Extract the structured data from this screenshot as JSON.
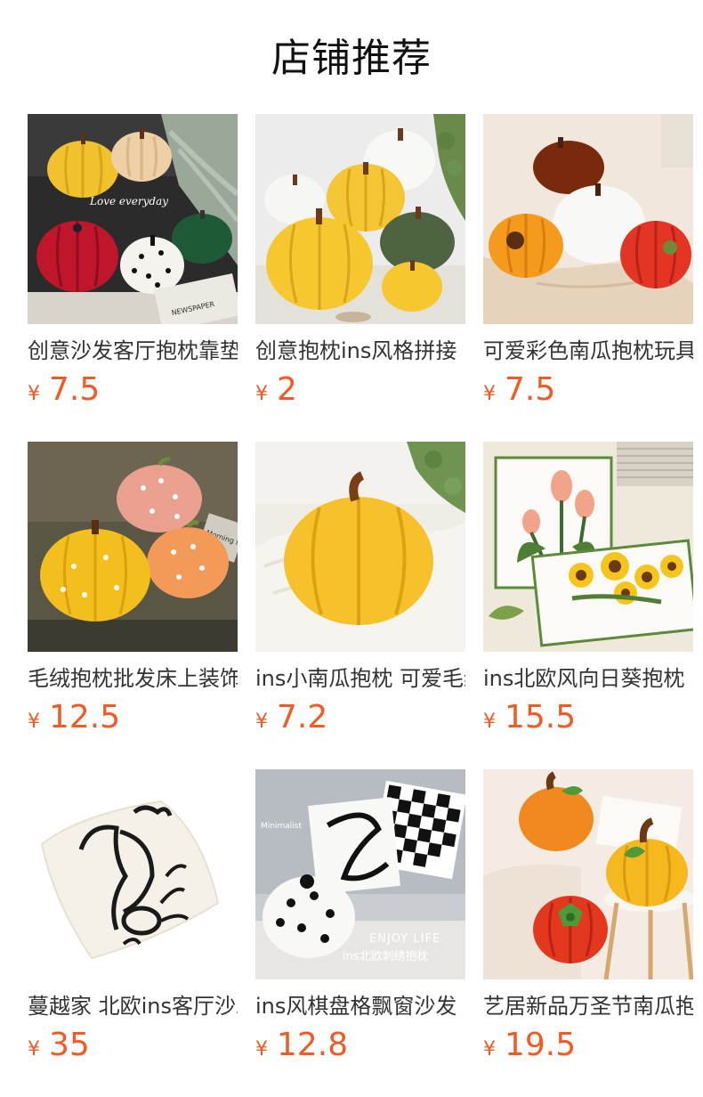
{
  "header": {
    "title": "店铺推荐"
  },
  "products": [
    {
      "name": "创意沙发客厅抱枕靠垫",
      "currency": "¥",
      "price": "7.5",
      "thumb_text_1": "Love everyday",
      "thumb_text_2": "NEWSPAPER"
    },
    {
      "name": "创意抱枕ins风格拼接",
      "currency": "¥",
      "price": "2"
    },
    {
      "name": "可爱彩色南瓜抱枕玩具",
      "currency": "¥",
      "price": "7.5"
    },
    {
      "name": "毛绒抱枕批发床上装饰",
      "currency": "¥",
      "price": "12.5",
      "thumb_text_1": "Morning News"
    },
    {
      "name": "ins小南瓜抱枕 可爱毛绒",
      "currency": "¥",
      "price": "7.2"
    },
    {
      "name": "ins北欧风向日葵抱枕",
      "currency": "¥",
      "price": "15.5"
    },
    {
      "name": "蔓越家 北欧ins客厅沙发",
      "currency": "¥",
      "price": "35"
    },
    {
      "name": "ins风棋盘格飘窗沙发",
      "currency": "¥",
      "price": "12.8",
      "thumb_text_1": "Minimalist",
      "thumb_text_2": "ENJOY LIFE",
      "thumb_text_3": "ins北欧刺绣抱枕"
    },
    {
      "name": "艺居新品万圣节南瓜抱枕",
      "currency": "¥",
      "price": "19.5"
    }
  ]
}
